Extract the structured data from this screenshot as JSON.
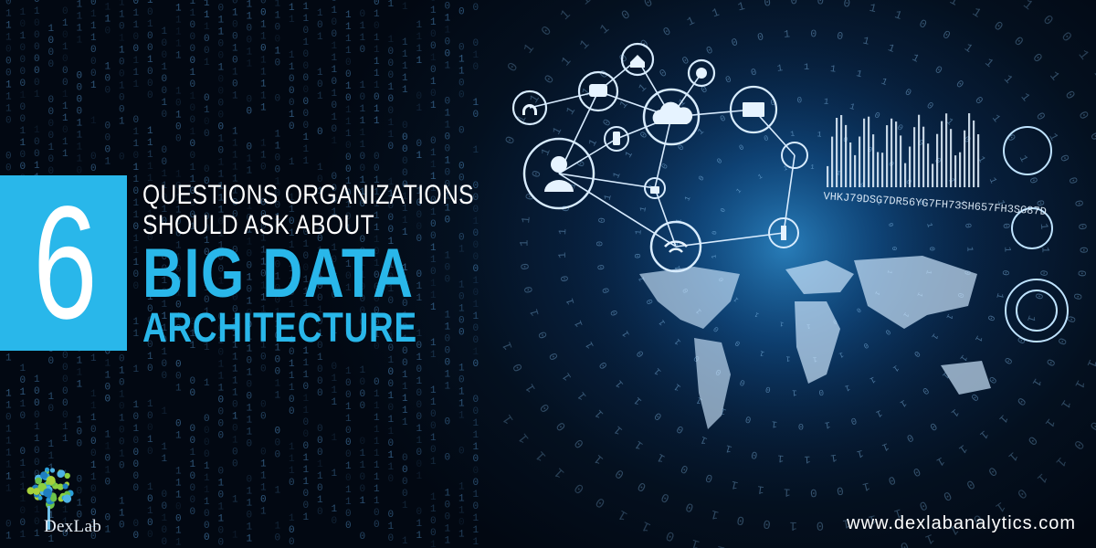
{
  "banner": {
    "number": "6",
    "line1": "QUESTIONS ORGANIZATIONS",
    "line2": "SHOULD ASK ABOUT",
    "line3": "BIG DATA",
    "line4": "ARCHITECTURE",
    "code_text": "VHKJ79DSG7DR56YG7FH73SH657FH3SG87D",
    "brand": "DexLab",
    "website": "www.dexlabanalytics.com",
    "colors": {
      "accent": "#29b7ea",
      "background": "#020812",
      "text": "#ffffff"
    },
    "icons": [
      "headset-icon",
      "user-icon",
      "chat-icon",
      "home-icon",
      "pie-chart-icon",
      "cloud-icon",
      "mail-icon",
      "phone-icon",
      "lock-icon",
      "wifi-icon",
      "person-icon"
    ]
  }
}
